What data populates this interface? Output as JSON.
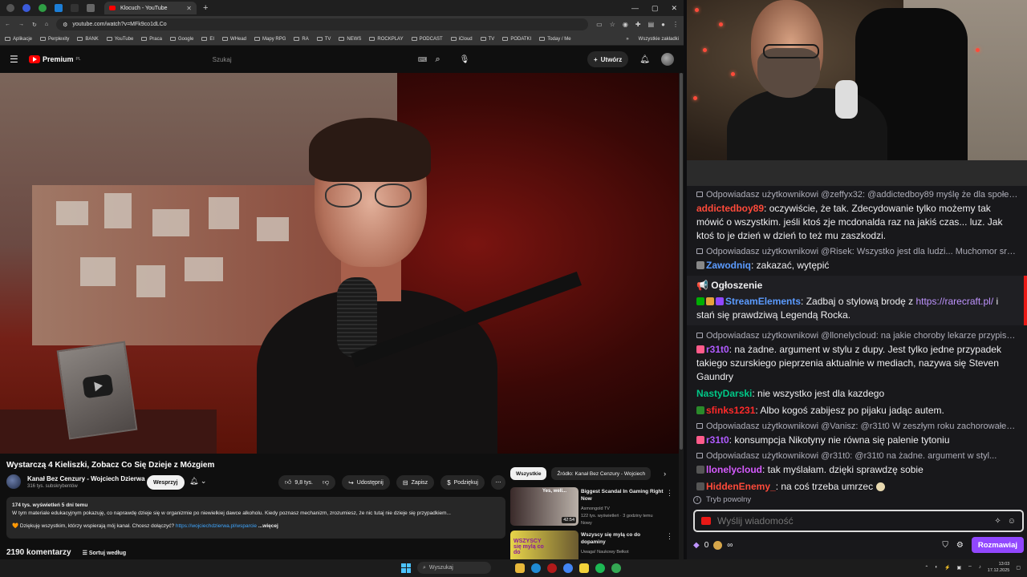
{
  "browser": {
    "tab_title": "Klocuch - YouTube",
    "new_tab": "+",
    "url": "youtube.com/watch?v=MFk9co1dLCo",
    "window_controls": [
      "—",
      "▢",
      "✕"
    ],
    "bookmarks": [
      "Aplikacje",
      "Perplexity",
      "BANK",
      "YouTube",
      "Praca",
      "Google",
      "EI",
      "WHead",
      "Mapy RPG",
      "RA",
      "TV",
      "NEWS",
      "ROCKPLAY",
      "PODCAST",
      "iCloud",
      "TV",
      "PODATKI",
      "Today / Me"
    ],
    "bookmarks_more": "»",
    "all_bookmarks": "Wszystkie zakładki"
  },
  "youtube": {
    "logo": "Premium",
    "logo_sup": "PL",
    "search_placeholder": "Szukaj",
    "create_label": "Utwórz",
    "video_title": "Wystarczą 4 Kieliszki, Zobacz Co Się Dzieje z Mózgiem",
    "channel_name": "Kanał Bez Cenzury - Wojciech Dzierwa",
    "channel_subs": "316 tys. subskrybentów",
    "support_label": "Wesprzyj",
    "likes": "9,8 tys.",
    "share_label": "Udostępnij",
    "save_label": "Zapisz",
    "thanks_label": "Podziękuj",
    "more_label": "⋯",
    "desc_stats": "174 tys. wyświetleń  5 dni temu",
    "desc_line1": "W tym materiale edukacyjnym pokazuję, co naprawdę dzieje się w organizmie po niewielkiej dawce alkoholu. Kiedy poznasz mechanizm, zrozumiesz, że nic tutaj nie dzieje się przypadkiem...",
    "desc_line2": "🧡 Dziękuję wszystkim, którzy wspierają mój kanał. Chcesz dołączyć?",
    "desc_link": "https://wojciechdzierwa.pl/wsparcie",
    "desc_more": "...więcej",
    "comments_count": "2190 komentarzy",
    "sort_label": "Sortuj według",
    "chips": [
      "Wszystkie",
      "Źródło: Kanał Bez Cenzury - Wojciech"
    ],
    "recommendations": [
      {
        "title": "Biggest Scandal In Gaming Right Now",
        "channel": "Asmongold TV",
        "meta": "122 tys. wyświetleń · 3 godziny temu",
        "badge": "Nowy",
        "duration": "42:54",
        "thumb_text": "Yes, well..."
      },
      {
        "title": "Wszyscy się mylą co do dopaminy",
        "channel": "Uwaga! Naukowy Bełkot",
        "meta": "",
        "badge": "",
        "duration": "",
        "thumb_text": "WSZYSCY się mylą co do"
      }
    ]
  },
  "twitch": {
    "messages": [
      {
        "type": "reply",
        "text": "Odpowiadasz użytkownikowi @zeffyx32: @addictedboy89 myślę że dla społec..."
      },
      {
        "type": "msg",
        "user": "addictedboy89",
        "color": "#ff4a3a",
        "badges": [],
        "text": ": oczywiście, że tak. Zdecydowanie tylko możemy tak mówić o wszystkim. jeśli ktoś zje mcdonalda raz na jakiś czas... luz. Jak ktoś to je dzień w dzień to też mu zaszkodzi."
      },
      {
        "type": "reply",
        "text": "Odpowiadasz użytkownikowi @Risek: Wszystko jest dla ludzi... Muchomor sro..."
      },
      {
        "type": "msg",
        "user": "Zawodniq",
        "color": "#5b9bff",
        "badges": [
          "#888888"
        ],
        "text": ": zakazać, wytępić"
      },
      {
        "type": "announce",
        "header": "📢 Ogłoszenie",
        "user": "StreamElements",
        "color": "#5b9bff",
        "badges": [
          "#00ad03",
          "#e6a23c",
          "#9147ff"
        ],
        "text1": ": Zadbaj o stylową brodę z ",
        "link": "https://rarecraft.pl/",
        "text2": " i stań się prawdziwą Legendą Rocka."
      },
      {
        "type": "reply",
        "text": "Odpowiadasz użytkownikowi @llonelycloud: na jakie choroby lekarze przypisuj..."
      },
      {
        "type": "msg",
        "user": "r31t0",
        "color": "#b05bff",
        "badges": [
          "#ff5b8a"
        ],
        "text": ": na żadne. argument w stylu z dupy. Jest tylko jedne przypadek takiego szurskiego pieprzenia aktualnie w mediach, nazywa się Steven Gaundry"
      },
      {
        "type": "msg",
        "user": "NastyDarski",
        "color": "#00c887",
        "badges": [],
        "text": ": nie wszystko jest dla kazdego"
      },
      {
        "type": "msg",
        "user": "sfinks1231",
        "color": "#ff2a2a",
        "badges": [
          "#2a8a2a"
        ],
        "text": ": Albo kogoś zabijesz po pijaku jadąc autem."
      },
      {
        "type": "reply",
        "text": "Odpowiadasz użytkownikowi @Vanisz: @r31t0 W zeszłym roku zachorowałem ..."
      },
      {
        "type": "msg",
        "user": "r31t0",
        "color": "#b05bff",
        "badges": [
          "#ff5b8a"
        ],
        "text": ": konsumpcja Nikotyny nie równa się palenie tytoniu"
      },
      {
        "type": "reply",
        "text": "Odpowiadasz użytkownikowi @r31t0: @r31t0 na żadne. argument w styl..."
      },
      {
        "type": "msg",
        "user": "llonelycloud",
        "color": "#d65bff",
        "badges": [
          "#555555"
        ],
        "text": ": tak myślałam. dzięki sprawdzę sobie"
      },
      {
        "type": "msg",
        "user": "HiddenEnemy_",
        "color": "#ff4a3a",
        "badges": [
          "#555555"
        ],
        "text": ": na coś trzeba umrzec",
        "emote": true
      }
    ],
    "slow_mode": "Tryb powolny",
    "input_placeholder": "Wyślij wiadomość",
    "points": "0",
    "send_label": "Rozmawiaj"
  },
  "taskbar": {
    "search_placeholder": "Wyszukaj",
    "time": "13:03",
    "date": "17.12.2025"
  }
}
